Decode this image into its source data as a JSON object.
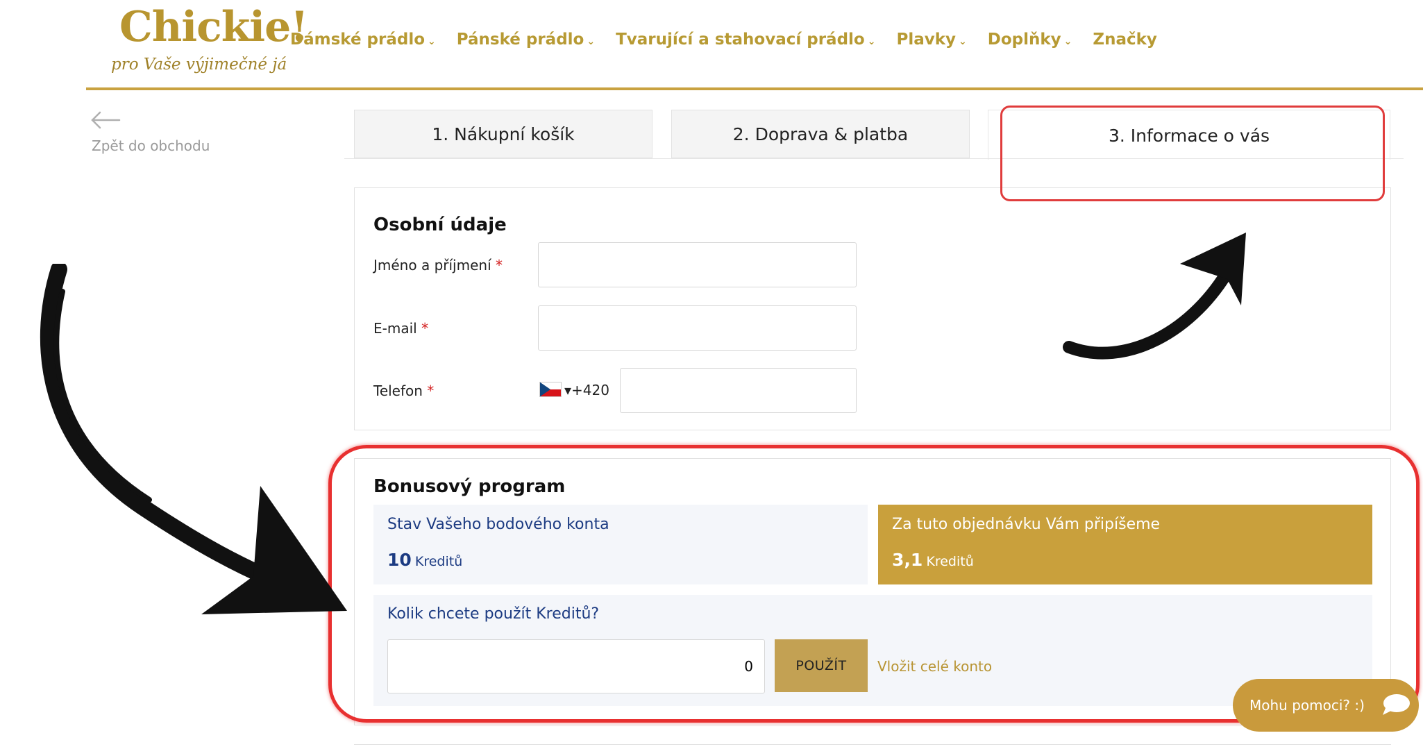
{
  "header": {
    "logo_text": "Chickie!",
    "logo_tagline": "pro Vaše výjimečné já",
    "nav": [
      {
        "label": "Dámské prádlo",
        "has_dropdown": true
      },
      {
        "label": "Pánské prádlo",
        "has_dropdown": true
      },
      {
        "label": "Tvarující a stahovací prádlo",
        "has_dropdown": true
      },
      {
        "label": "Plavky",
        "has_dropdown": true
      },
      {
        "label": "Doplňky",
        "has_dropdown": true
      },
      {
        "label": "Značky",
        "has_dropdown": false
      }
    ],
    "dropdown_icon": "chevron-down-icon"
  },
  "back": {
    "label": "Zpět do obchodu",
    "icon": "arrow-left-icon"
  },
  "steps": [
    {
      "label": "1. Nákupní košík",
      "active": false
    },
    {
      "label": "2. Doprava & platba",
      "active": false
    },
    {
      "label": "3. Informace o vás",
      "active": true
    }
  ],
  "personal": {
    "title": "Osobní údaje",
    "required_mark": "*",
    "name_label": "Jméno a příjmení",
    "name_value": "",
    "email_label": "E-mail",
    "email_value": "",
    "phone_label": "Telefon",
    "phone_country": "CZ",
    "phone_prefix": "+420",
    "phone_value": ""
  },
  "bonus": {
    "title": "Bonusový program",
    "balance_label": "Stav Vašeho bodového konta",
    "balance_value": "10",
    "balance_unit": "Kreditů",
    "earn_label": "Za tuto objednávku Vám připíšeme",
    "earn_value": "3,1",
    "earn_unit": "Kreditů",
    "use_question": "Kolik chcete použít Kreditů?",
    "use_value": "0",
    "use_button": "POUŽÍT",
    "whole_link": "Vložit celé konto"
  },
  "chat": {
    "label": "Mohu pomoci? :)",
    "icon": "chat-bubble-icon"
  },
  "colors": {
    "brand_gold": "#c9a03c",
    "nav_gold": "#b79a33",
    "credit_blue": "#1c3b82",
    "highlight_red": "#e03c3c",
    "required_red": "#d32020"
  }
}
